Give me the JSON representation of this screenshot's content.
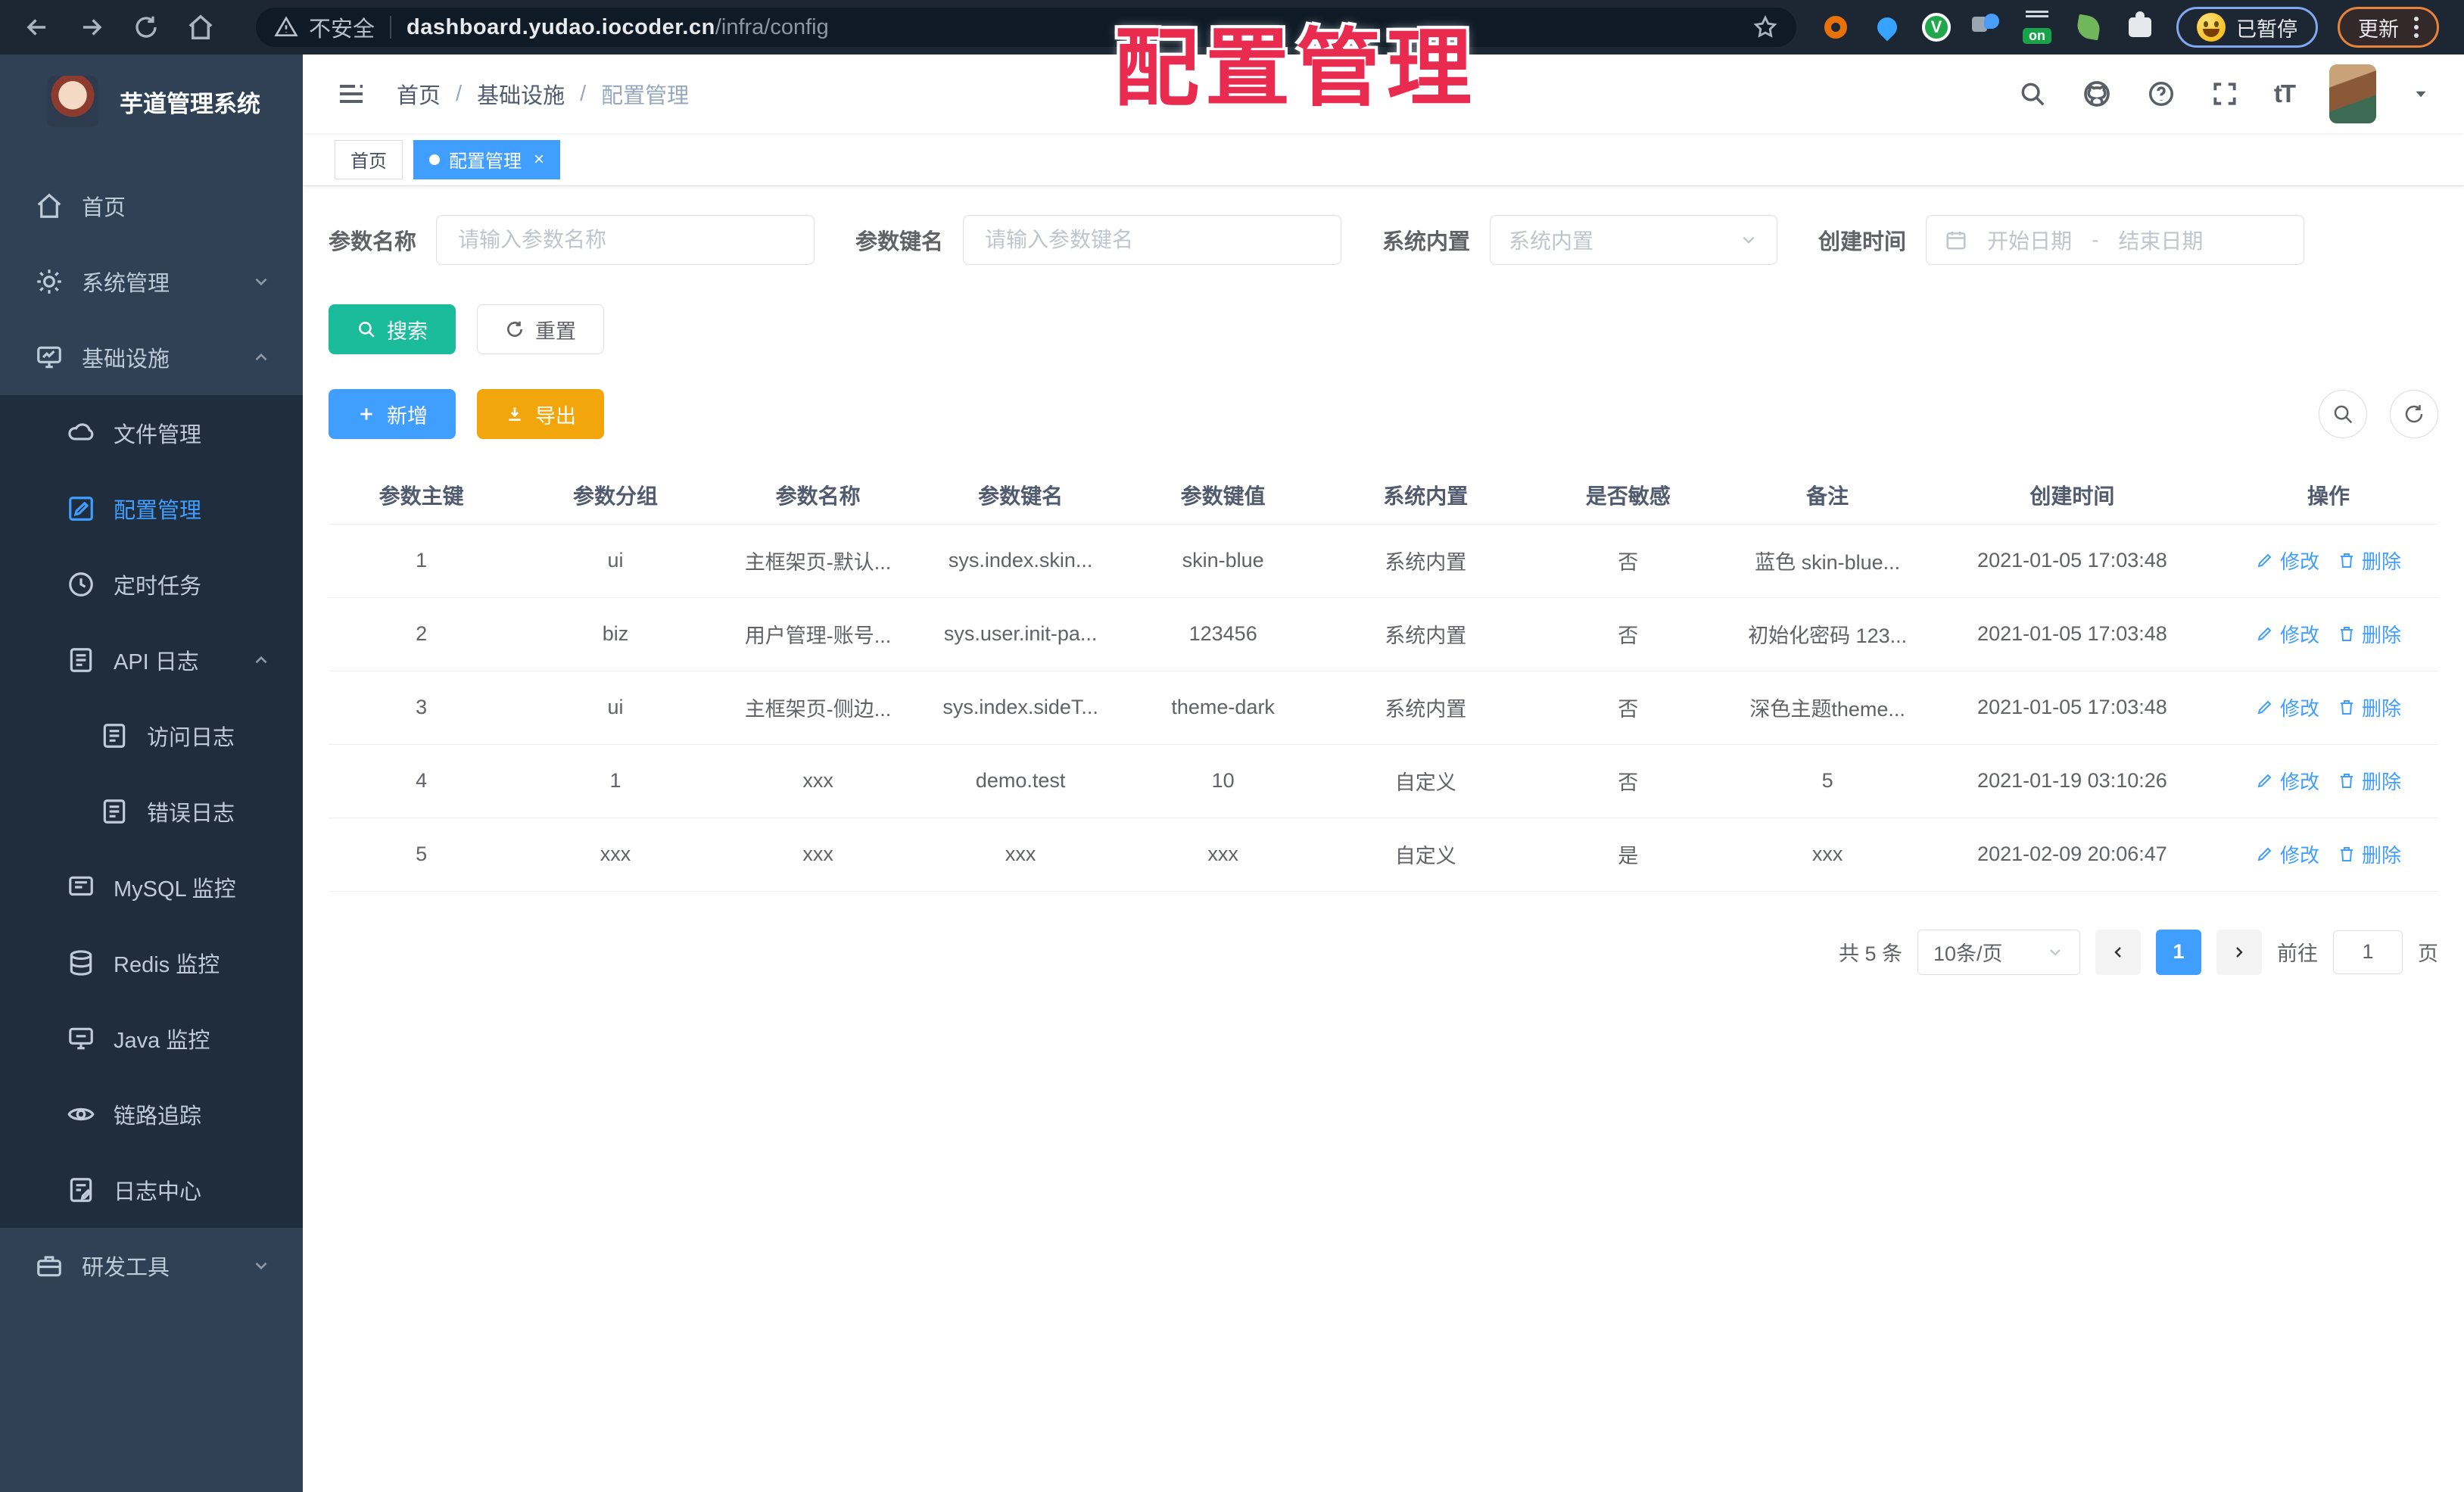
{
  "browser": {
    "security_label": "不安全",
    "url_host": "dashboard.yudao.iocoder.cn",
    "url_path": "/infra/config",
    "paused_badge": "已暂停",
    "update_button": "更新",
    "extension_on_badge": "on",
    "extension_v_badge": "V"
  },
  "watermark": "配置管理",
  "sidebar": {
    "title": "芋道管理系统",
    "items": [
      {
        "label": "首页",
        "icon": "home-icon"
      },
      {
        "label": "系统管理",
        "icon": "gear-icon",
        "chevron": "down"
      },
      {
        "label": "基础设施",
        "icon": "monitor-icon",
        "chevron": "up"
      },
      {
        "label": "文件管理",
        "icon": "cloud-icon"
      },
      {
        "label": "配置管理",
        "icon": "edit-square-icon",
        "active": true
      },
      {
        "label": "定时任务",
        "icon": "clock-icon"
      },
      {
        "label": "API 日志",
        "icon": "document-edit-icon",
        "chevron": "up"
      },
      {
        "label": "访问日志",
        "icon": "document-edit-icon"
      },
      {
        "label": "错误日志",
        "icon": "document-edit-icon"
      },
      {
        "label": "MySQL 监控",
        "icon": "mysql-monitor-icon"
      },
      {
        "label": "Redis 监控",
        "icon": "database-icon"
      },
      {
        "label": "Java 监控",
        "icon": "java-monitor-icon"
      },
      {
        "label": "链路追踪",
        "icon": "eye-icon"
      },
      {
        "label": "日志中心",
        "icon": "document-edit-icon"
      },
      {
        "label": "研发工具",
        "icon": "briefcase-icon",
        "chevron": "down"
      }
    ]
  },
  "header": {
    "breadcrumb": [
      "首页",
      "基础设施",
      "配置管理"
    ],
    "sep": "/",
    "tags": [
      {
        "label": "首页",
        "active": false
      },
      {
        "label": "配置管理",
        "active": true
      }
    ]
  },
  "filters": {
    "name_label": "参数名称",
    "name_placeholder": "请输入参数名称",
    "key_label": "参数键名",
    "key_placeholder": "请输入参数键名",
    "type_label": "系统内置",
    "type_placeholder": "系统内置",
    "date_label": "创建时间",
    "date_start": "开始日期",
    "date_sep": "-",
    "date_end": "结束日期",
    "search_label": "搜索",
    "reset_label": "重置",
    "add_label": "新增",
    "export_label": "导出"
  },
  "table": {
    "columns": [
      "参数主键",
      "参数分组",
      "参数名称",
      "参数键名",
      "参数键值",
      "系统内置",
      "是否敏感",
      "备注",
      "创建时间",
      "操作"
    ],
    "edit_label": "修改",
    "delete_label": "删除",
    "rows": [
      {
        "cells": [
          "1",
          "ui",
          "主框架页-默认...",
          "sys.index.skin...",
          "skin-blue",
          "系统内置",
          "否",
          "蓝色 skin-blue...",
          "2021-01-05 17:03:48"
        ]
      },
      {
        "cells": [
          "2",
          "biz",
          "用户管理-账号...",
          "sys.user.init-pa...",
          "123456",
          "系统内置",
          "否",
          "初始化密码 123...",
          "2021-01-05 17:03:48"
        ]
      },
      {
        "cells": [
          "3",
          "ui",
          "主框架页-侧边...",
          "sys.index.sideT...",
          "theme-dark",
          "系统内置",
          "否",
          "深色主题theme...",
          "2021-01-05 17:03:48"
        ]
      },
      {
        "cells": [
          "4",
          "1",
          "xxx",
          "demo.test",
          "10",
          "自定义",
          "否",
          "5",
          "2021-01-19 03:10:26"
        ]
      },
      {
        "cells": [
          "5",
          "xxx",
          "xxx",
          "xxx",
          "xxx",
          "自定义",
          "是",
          "xxx",
          "2021-02-09 20:06:47"
        ]
      }
    ]
  },
  "pagination": {
    "total": "共 5 条",
    "page_size": "10条/页",
    "current_page": "1",
    "goto_label": "前往",
    "goto_value": "1",
    "page_label": "页"
  },
  "icons": {
    "accent_color": "#409eff",
    "search_button_color": "#1abc9c",
    "export_button_color": "#f2a60c",
    "sidebar_bg": "#304156",
    "sidebar_sub_bg": "#1f2d3d",
    "chrome_bg": "#1d2733",
    "watermark_color": "#ea2b50",
    "names": [
      "back-icon",
      "forward-icon",
      "reload-icon",
      "home-icon",
      "warning-icon",
      "star-icon",
      "extension-icon",
      "menu-dots-icon",
      "hamburger-icon",
      "search-icon",
      "github-icon",
      "help-icon",
      "fullscreen-icon",
      "font-size-icon",
      "calendar-icon",
      "refresh-icon",
      "plus-icon",
      "download-icon",
      "edit-icon",
      "delete-icon",
      "chevron-icon",
      "close-icon"
    ]
  }
}
